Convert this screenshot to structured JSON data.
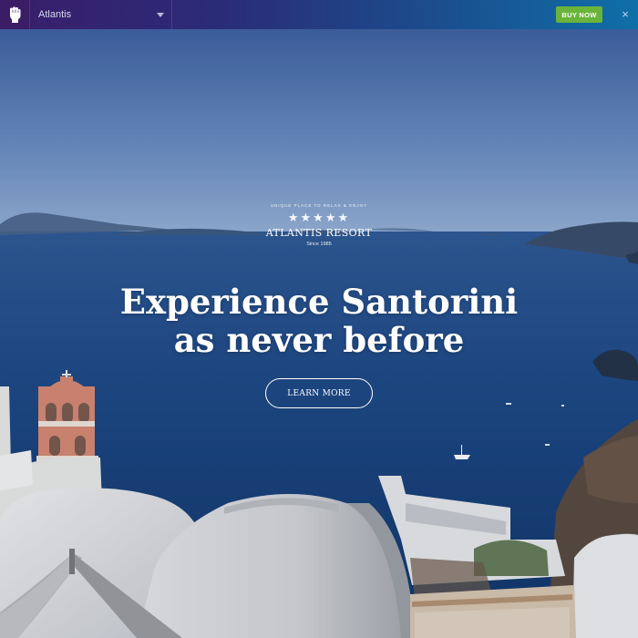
{
  "topbar": {
    "theme_name": "Atlantis",
    "buy_label": "BUY NOW",
    "close_symbol": "×"
  },
  "logo": {
    "tagline": "UNIQUE PLACE TO RELAX & ENJOY",
    "stars": "★★★★★",
    "name": "ATLANTIS RESORT",
    "since": "Since 1985"
  },
  "hero": {
    "headline_line1": "Experience Santorini",
    "headline_line2": "as never before",
    "cta_label": "LEARN MORE"
  },
  "colors": {
    "buy_button": "#6ab43a",
    "sea": "#1f4a86",
    "sky": "#6f92c4"
  },
  "icons": {
    "brand": "raised-fist-icon",
    "dropdown": "caret-down-icon",
    "close": "close-icon"
  }
}
